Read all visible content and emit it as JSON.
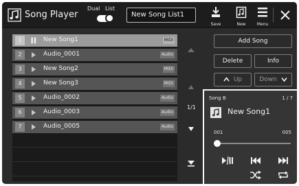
{
  "app": {
    "title": "Song Player",
    "mode_dual_label": "Dual",
    "mode_list_label": "List",
    "song_list_name": "New Song List1",
    "toolbar": {
      "save_label": "Save",
      "new_label": "New",
      "menu_label": "Menu"
    }
  },
  "songs": [
    {
      "number": "1",
      "name": "New Song1",
      "type": "MIDI",
      "state": "playing"
    },
    {
      "number": "2",
      "name": "Audio_0001",
      "type": "Audio",
      "state": "idle"
    },
    {
      "number": "3",
      "name": "New Song2",
      "type": "MIDI",
      "state": "idle"
    },
    {
      "number": "4",
      "name": "New Song3",
      "type": "MIDI",
      "state": "idle"
    },
    {
      "number": "5",
      "name": "Audio_0002",
      "type": "Audio",
      "state": "idle"
    },
    {
      "number": "6",
      "name": "Audio_0003",
      "type": "Audio",
      "state": "idle"
    },
    {
      "number": "7",
      "name": "Audio_0005",
      "type": "Audio",
      "state": "idle"
    }
  ],
  "list_page": "1/1",
  "actions": {
    "add_song": "Add Song",
    "delete": "Delete",
    "info": "Info",
    "up": "Up",
    "down": "Down"
  },
  "player": {
    "slot_label": "Song B",
    "position": "1 / 7",
    "song_name": "New Song1",
    "bar_start": "001",
    "bar_end": "005",
    "progress": 0
  },
  "colors": {
    "background": "#2b2b2b",
    "titlebar": "#1d1d1d",
    "selected_row": "#9b9b9b",
    "player_highlight": "#f7f7f7"
  }
}
